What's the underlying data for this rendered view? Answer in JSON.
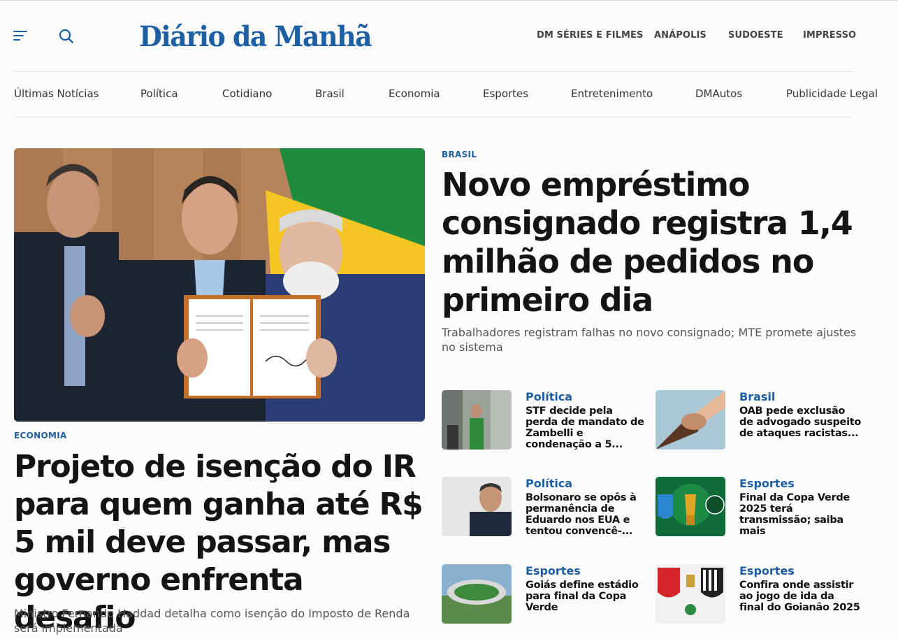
{
  "header": {
    "logo": "Diário da Manhã",
    "top_links": [
      "DM SÉRIES E FILMES",
      "ANÁPOLIS",
      "SUDOESTE",
      "IMPRESSO"
    ]
  },
  "categories": [
    "Últimas Notícias",
    "Política",
    "Cotidiano",
    "Brasil",
    "Economia",
    "Esportes",
    "Entretenimento",
    "DMAutos",
    "Publicidade Legal"
  ],
  "main_story": {
    "kicker": "ECONOMIA",
    "headline": "Projeto de isenção do IR para quem ganha até R$ 5 mil deve passar, mas governo enfrenta desafio",
    "subtitle": "Ministro Fernando Haddad detalha como isenção do Imposto de Renda será implementada"
  },
  "secondary_story": {
    "kicker": "BRASIL",
    "headline": "Novo empréstimo consignado registra 1,4 milhão de pedidos no primeiro dia",
    "subtitle": "Trabalhadores registram falhas no novo consignado; MTE promete ajustes no sistema"
  },
  "cards": [
    {
      "category": "Política",
      "title": "STF decide pela perda de mandato de Zambelli e condenação a 5..."
    },
    {
      "category": "Brasil",
      "title": "OAB pede exclusão de advogado suspeito de ataques racistas..."
    },
    {
      "category": "Política",
      "title": "Bolsonaro se opôs à permanência de Eduardo nos EUA e tentou convencê-..."
    },
    {
      "category": "Esportes",
      "title": "Final da Copa Verde 2025 terá transmissão; saiba mais"
    },
    {
      "category": "Esportes",
      "title": "Goiás define estádio para final da Copa Verde"
    },
    {
      "category": "Esportes",
      "title": "Confira onde assistir ao jogo de ida da final do Goianão 2025"
    }
  ],
  "colors": {
    "brand": "#1d5fa5",
    "headline": "#141414"
  }
}
